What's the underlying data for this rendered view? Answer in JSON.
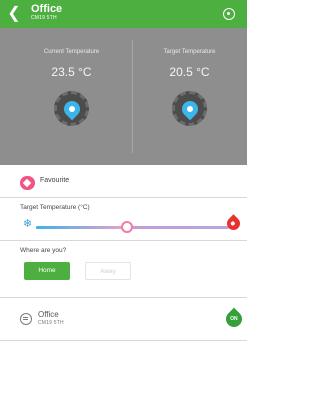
{
  "header": {
    "title": "Office",
    "subtitle": "CM19 5TH",
    "back_icon": "chevron-left-icon",
    "power_icon": "power-icon",
    "color": "#4caf3f"
  },
  "temperatures": {
    "current": {
      "label": "Current Temperature",
      "value": "23.5 °C"
    },
    "target": {
      "label": "Target Temperature",
      "value": "20.5 °C"
    }
  },
  "favourite": {
    "label": "Favourite",
    "icon": "heart-icon",
    "color": "#f25584"
  },
  "target_slider": {
    "label": "Target Temperature (°C)",
    "min_icon": "snowflake-icon",
    "max_icon": "flame-icon",
    "level": 0.46
  },
  "presence": {
    "question": "Where are you?",
    "options": [
      {
        "label": "Home",
        "selected": true
      },
      {
        "label": "Away",
        "selected": false
      }
    ]
  },
  "device": {
    "name": "Office",
    "sub": "CM19 5TH",
    "status": "ON",
    "status_color": "#35a03a"
  }
}
